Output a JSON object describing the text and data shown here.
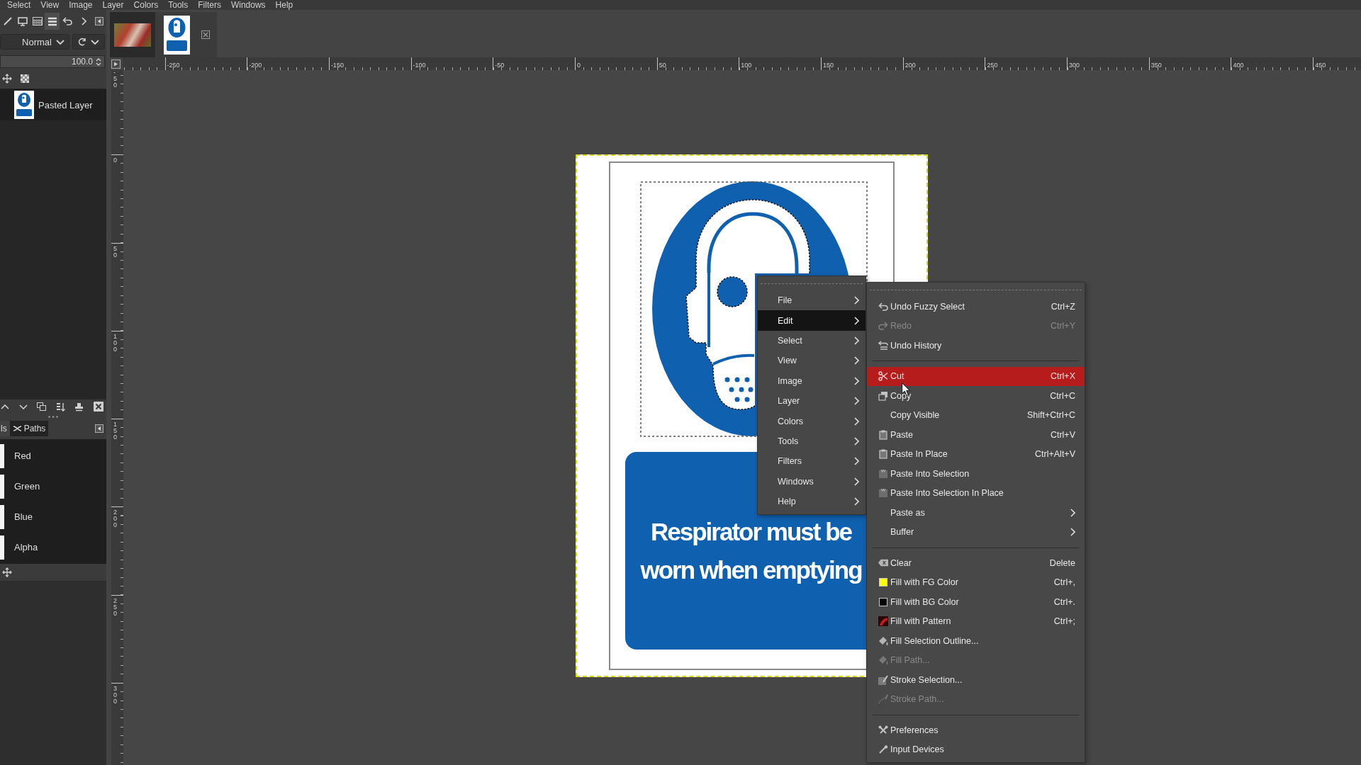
{
  "menu_bar": {
    "items": [
      "Select",
      "View",
      "Image",
      "Layer",
      "Colors",
      "Tools",
      "Filters",
      "Windows",
      "Help"
    ]
  },
  "layers_dock": {
    "tabs": [
      {
        "selected": false
      },
      {
        "selected": false
      },
      {
        "selected": false
      },
      {
        "selected": true
      },
      {
        "selected": false
      }
    ],
    "mode": "Normal",
    "opacity": {
      "value": "100.0",
      "level": 1
    },
    "layers": [
      {
        "name": "Pasted Layer"
      }
    ]
  },
  "channels_dock": {
    "tabs": [
      {
        "label": "ls",
        "selected": true
      },
      {
        "label": "Paths",
        "selected": false
      }
    ],
    "channels": [
      {
        "name": "Red"
      },
      {
        "name": "Green"
      },
      {
        "name": "Blue"
      },
      {
        "name": "Alpha"
      }
    ]
  },
  "image_tabs": [
    {
      "selected": false
    },
    {
      "selected": true
    }
  ],
  "horizontal_ruler": {
    "labels": [
      "-250",
      "-200",
      "-150",
      "-100",
      "-50",
      "0",
      "50",
      "100",
      "150",
      "200",
      "250",
      "300",
      "350",
      "400",
      "450"
    ]
  },
  "vertical_ruler": {
    "labels": [
      "-50",
      "0",
      "50",
      "100",
      "150",
      "200",
      "250",
      "300"
    ]
  },
  "image": {
    "sign_text": [
      "Respirator must be",
      "worn when emptying"
    ]
  },
  "context_menu": {
    "items": [
      {
        "label": "File",
        "selected": false,
        "submenu": true
      },
      {
        "label": "Edit",
        "selected": true,
        "submenu": true
      },
      {
        "label": "Select",
        "selected": false,
        "submenu": true
      },
      {
        "label": "View",
        "selected": false,
        "submenu": true
      },
      {
        "label": "Image",
        "selected": false,
        "submenu": true
      },
      {
        "label": "Layer",
        "selected": false,
        "submenu": true
      },
      {
        "label": "Colors",
        "selected": false,
        "submenu": true
      },
      {
        "label": "Tools",
        "selected": false,
        "submenu": true
      },
      {
        "label": "Filters",
        "selected": false,
        "submenu": true
      },
      {
        "label": "Windows",
        "selected": false,
        "submenu": true
      },
      {
        "label": "Help",
        "selected": false,
        "submenu": true
      }
    ]
  },
  "edit_submenu": {
    "groups": [
      {
        "items": [
          {
            "label": "Undo Fuzzy Select",
            "shortcut": "Ctrl+Z",
            "selected": false,
            "disabled": false,
            "submenu": false
          },
          {
            "label": "Redo",
            "shortcut": "Ctrl+Y",
            "selected": false,
            "disabled": true,
            "submenu": false
          },
          {
            "label": "Undo History",
            "selected": false,
            "disabled": false,
            "submenu": false
          }
        ]
      },
      {
        "items": [
          {
            "label": "Cut",
            "shortcut": "Ctrl+X",
            "selected": true,
            "disabled": false,
            "submenu": false
          },
          {
            "label": "Copy",
            "shortcut": "Ctrl+C",
            "selected": false,
            "disabled": false,
            "submenu": false
          },
          {
            "label": "Copy Visible",
            "shortcut": "Shift+Ctrl+C",
            "selected": false,
            "disabled": false,
            "submenu": false
          },
          {
            "label": "Paste",
            "shortcut": "Ctrl+V",
            "selected": false,
            "disabled": false,
            "submenu": false
          },
          {
            "label": "Paste In Place",
            "shortcut": "Ctrl+Alt+V",
            "selected": false,
            "disabled": false,
            "submenu": false
          },
          {
            "label": "Paste Into Selection",
            "selected": false,
            "disabled": false,
            "submenu": false
          },
          {
            "label": "Paste Into Selection In Place",
            "selected": false,
            "disabled": false,
            "submenu": false
          },
          {
            "label": "Paste as",
            "selected": false,
            "disabled": false,
            "submenu": true
          },
          {
            "label": "Buffer",
            "selected": false,
            "disabled": false,
            "submenu": true
          }
        ]
      },
      {
        "items": [
          {
            "label": "Clear",
            "shortcut": "Delete",
            "selected": false,
            "disabled": false,
            "submenu": false
          },
          {
            "label": "Fill with FG Color",
            "shortcut": "Ctrl+,",
            "color": "#ffff00",
            "selected": false,
            "disabled": false,
            "submenu": false
          },
          {
            "label": "Fill with BG Color",
            "shortcut": "Ctrl+.",
            "color": "#000000",
            "selected": false,
            "disabled": false,
            "submenu": false
          },
          {
            "label": "Fill with Pattern",
            "shortcut": "Ctrl+;",
            "selected": false,
            "disabled": false,
            "submenu": false
          },
          {
            "label": "Fill Selection Outline...",
            "selected": false,
            "disabled": false,
            "submenu": false
          },
          {
            "label": "Fill Path...",
            "selected": false,
            "disabled": true,
            "submenu": false
          },
          {
            "label": "Stroke Selection...",
            "selected": false,
            "disabled": false,
            "submenu": false
          },
          {
            "label": "Stroke Path...",
            "selected": false,
            "disabled": true,
            "submenu": false
          }
        ]
      },
      {
        "items": [
          {
            "label": "Preferences",
            "selected": false,
            "disabled": false,
            "submenu": false
          },
          {
            "label": "Input Devices",
            "selected": false,
            "disabled": false,
            "submenu": false
          }
        ]
      }
    ]
  }
}
